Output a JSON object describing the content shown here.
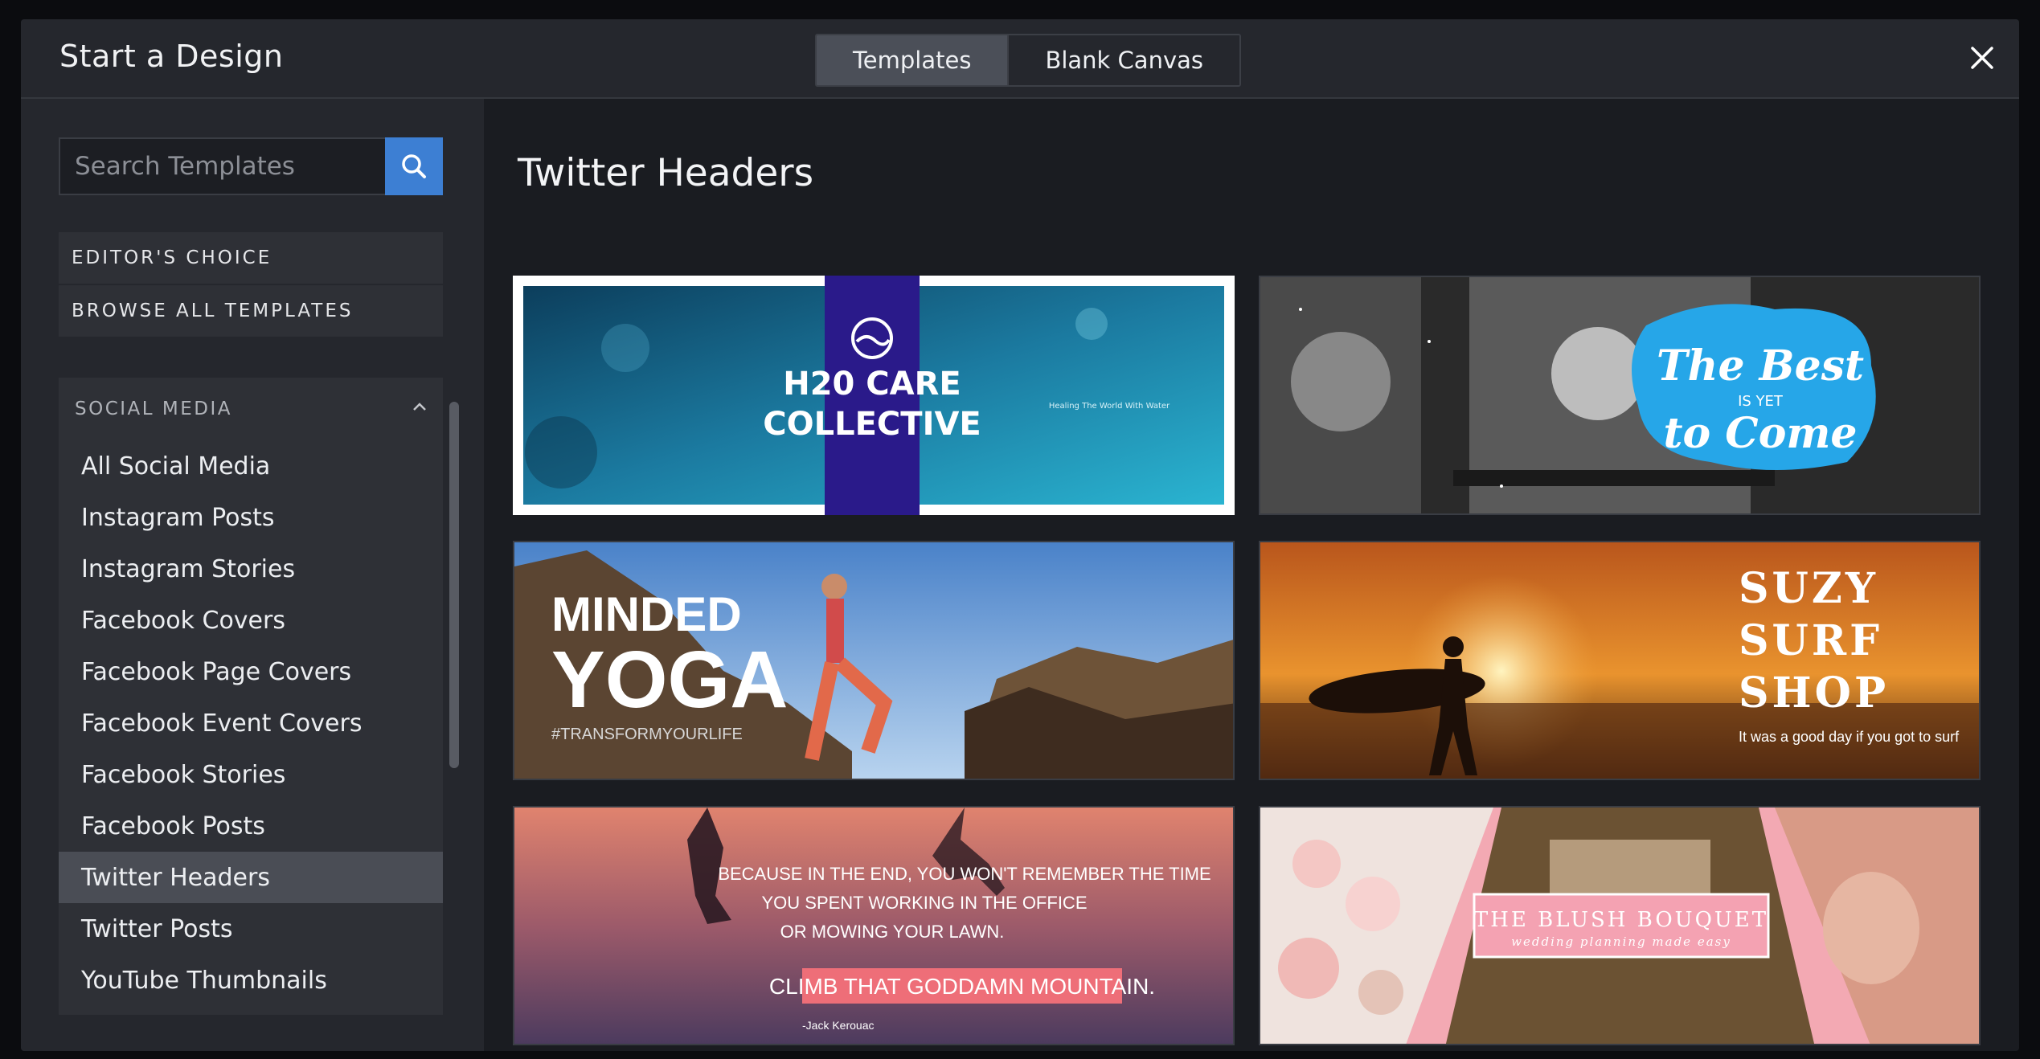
{
  "header": {
    "title": "Start a Design",
    "tabs": [
      {
        "label": "Templates",
        "active": true
      },
      {
        "label": "Blank Canvas",
        "active": false
      }
    ]
  },
  "sidebar": {
    "search_placeholder": "Search Templates",
    "top_links": [
      "EDITOR'S CHOICE",
      "BROWSE ALL TEMPLATES"
    ],
    "section_title": "SOCIAL MEDIA",
    "items": [
      "All Social Media",
      "Instagram Posts",
      "Instagram Stories",
      "Facebook Covers",
      "Facebook Page Covers",
      "Facebook Event Covers",
      "Facebook Stories",
      "Facebook Posts",
      "Twitter Headers",
      "Twitter Posts",
      "YouTube Thumbnails"
    ],
    "active_item": "Twitter Headers"
  },
  "main": {
    "title": "Twitter Headers",
    "templates": [
      {
        "line1": "H20 CARE",
        "line2": "COLLECTIVE",
        "tagline": "Healing The World With Water"
      },
      {
        "line1": "The Best",
        "line2": "IS YET",
        "line3": "to Come"
      },
      {
        "line1": "MINDED",
        "line2": "YOGA",
        "tagline": "#TRANSFORMYOURLIFE"
      },
      {
        "line1": "SUZY",
        "line2": "SURF",
        "line3": "SHOP",
        "tagline": "It was a good day if you got to surf"
      },
      {
        "line1": "BECAUSE IN THE END, YOU WON'T REMEMBER THE TIME",
        "line2": "YOU SPENT WORKING IN THE OFFICE",
        "line3": "OR MOWING YOUR LAWN.",
        "highlight": "CLIMB THAT GODDAMN MOUNTAIN.",
        "author": "-Jack Kerouac"
      },
      {
        "line1": "THE BLUSH BOUQUET",
        "tagline": "wedding planning made easy"
      }
    ]
  },
  "colors": {
    "accent": "#3d7fd3",
    "active_item": "#4a4d55",
    "panel": "#25272d"
  }
}
